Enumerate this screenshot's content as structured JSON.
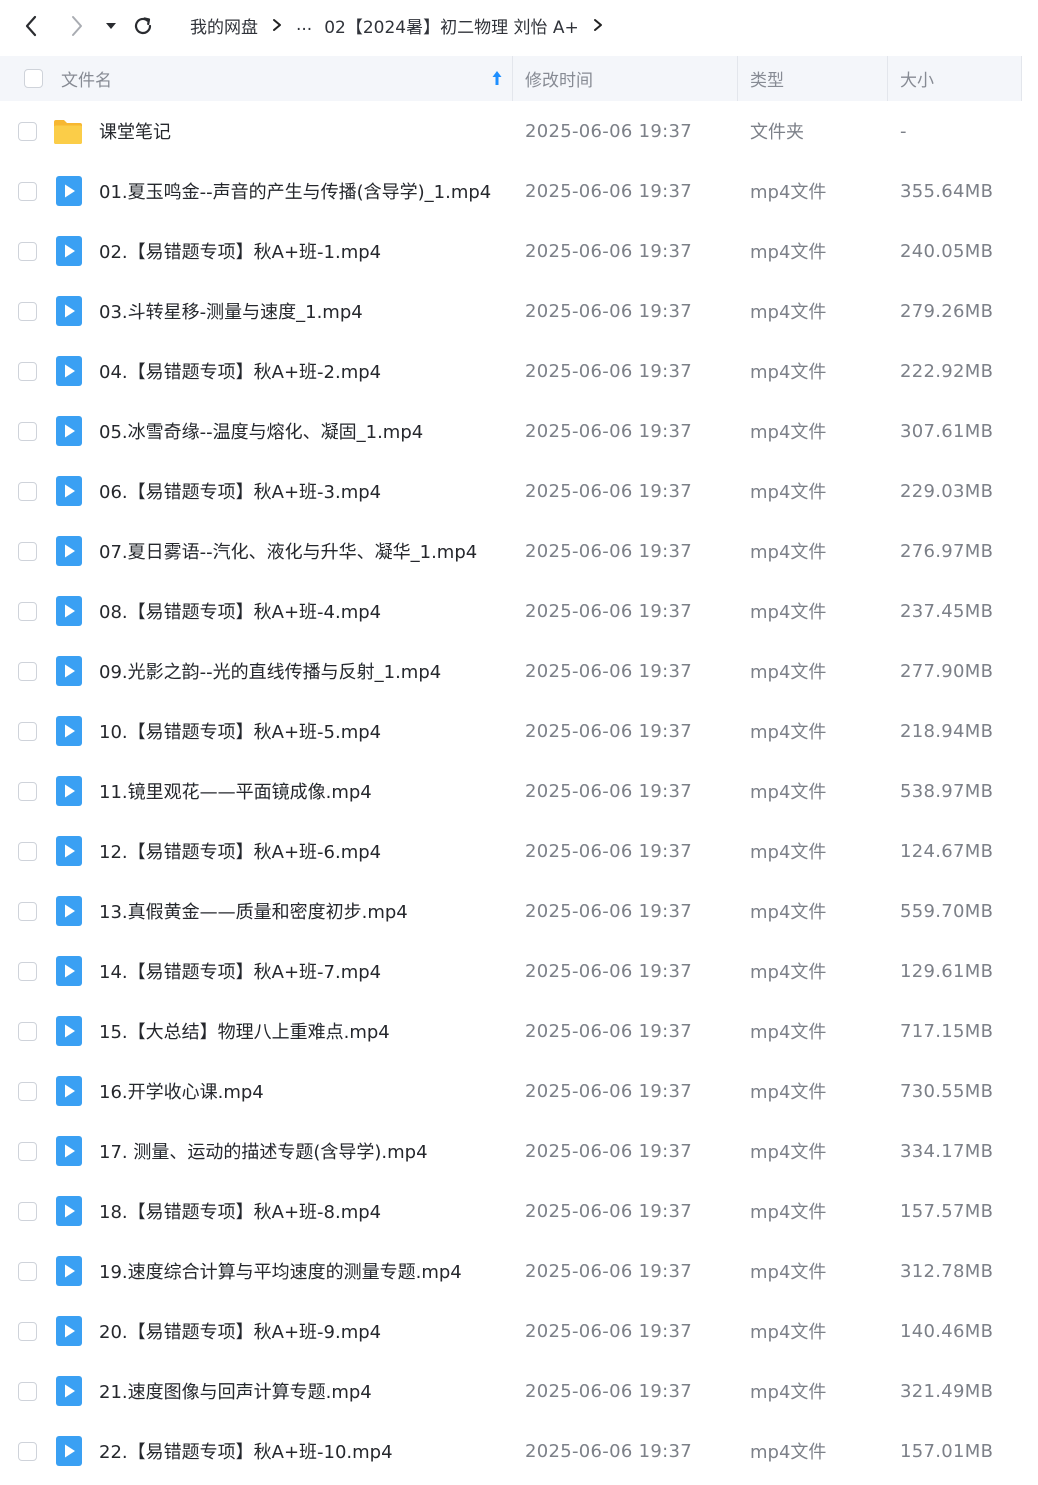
{
  "breadcrumb": {
    "root": "我的网盘",
    "ellipsis": "...",
    "current": "02【2024暑】初二物理 刘怡 A+"
  },
  "columns": {
    "name": "文件名",
    "modified": "修改时间",
    "type": "类型",
    "size": "大小"
  },
  "colors": {
    "accent": "#1e8fff",
    "folder": "#f9c646",
    "video_icon": "#3aa0f3",
    "header_bg": "#f4f6fa"
  },
  "files": [
    {
      "icon": "folder-icon",
      "name": "课堂笔记",
      "modified": "2025-06-06 19:37",
      "type": "文件夹",
      "size": "-"
    },
    {
      "icon": "video-file-icon",
      "name": "01.夏玉鸣金--声音的产生与传播(含导学)_1.mp4",
      "modified": "2025-06-06 19:37",
      "type": "mp4文件",
      "size": "355.64MB"
    },
    {
      "icon": "video-file-icon",
      "name": "02.【易错题专项】秋A+班-1.mp4",
      "modified": "2025-06-06 19:37",
      "type": "mp4文件",
      "size": "240.05MB"
    },
    {
      "icon": "video-file-icon",
      "name": "03.斗转星移-测量与速度_1.mp4",
      "modified": "2025-06-06 19:37",
      "type": "mp4文件",
      "size": "279.26MB"
    },
    {
      "icon": "video-file-icon",
      "name": "04.【易错题专项】秋A+班-2.mp4",
      "modified": "2025-06-06 19:37",
      "type": "mp4文件",
      "size": "222.92MB"
    },
    {
      "icon": "video-file-icon",
      "name": "05.冰雪奇缘--温度与熔化、凝固_1.mp4",
      "modified": "2025-06-06 19:37",
      "type": "mp4文件",
      "size": "307.61MB"
    },
    {
      "icon": "video-file-icon",
      "name": "06.【易错题专项】秋A+班-3.mp4",
      "modified": "2025-06-06 19:37",
      "type": "mp4文件",
      "size": "229.03MB"
    },
    {
      "icon": "video-file-icon",
      "name": "07.夏日雾语--汽化、液化与升华、凝华_1.mp4",
      "modified": "2025-06-06 19:37",
      "type": "mp4文件",
      "size": "276.97MB"
    },
    {
      "icon": "video-file-icon",
      "name": "08.【易错题专项】秋A+班-4.mp4",
      "modified": "2025-06-06 19:37",
      "type": "mp4文件",
      "size": "237.45MB"
    },
    {
      "icon": "video-file-icon",
      "name": "09.光影之韵--光的直线传播与反射_1.mp4",
      "modified": "2025-06-06 19:37",
      "type": "mp4文件",
      "size": "277.90MB"
    },
    {
      "icon": "video-file-icon",
      "name": "10.【易错题专项】秋A+班-5.mp4",
      "modified": "2025-06-06 19:37",
      "type": "mp4文件",
      "size": "218.94MB"
    },
    {
      "icon": "video-file-icon",
      "name": "11.镜里观花——平面镜成像.mp4",
      "modified": "2025-06-06 19:37",
      "type": "mp4文件",
      "size": "538.97MB"
    },
    {
      "icon": "video-file-icon",
      "name": "12.【易错题专项】秋A+班-6.mp4",
      "modified": "2025-06-06 19:37",
      "type": "mp4文件",
      "size": "124.67MB"
    },
    {
      "icon": "video-file-icon",
      "name": "13.真假黄金——质量和密度初步.mp4",
      "modified": "2025-06-06 19:37",
      "type": "mp4文件",
      "size": "559.70MB"
    },
    {
      "icon": "video-file-icon",
      "name": "14.【易错题专项】秋A+班-7.mp4",
      "modified": "2025-06-06 19:37",
      "type": "mp4文件",
      "size": "129.61MB"
    },
    {
      "icon": "video-file-icon",
      "name": "15.【大总结】物理八上重难点.mp4",
      "modified": "2025-06-06 19:37",
      "type": "mp4文件",
      "size": "717.15MB"
    },
    {
      "icon": "video-file-icon",
      "name": "16.开学收心课.mp4",
      "modified": "2025-06-06 19:37",
      "type": "mp4文件",
      "size": "730.55MB"
    },
    {
      "icon": "video-file-icon",
      "name": "17. 测量、运动的描述专题(含导学).mp4",
      "modified": "2025-06-06 19:37",
      "type": "mp4文件",
      "size": "334.17MB"
    },
    {
      "icon": "video-file-icon",
      "name": "18.【易错题专项】秋A+班-8.mp4",
      "modified": "2025-06-06 19:37",
      "type": "mp4文件",
      "size": "157.57MB"
    },
    {
      "icon": "video-file-icon",
      "name": "19.速度综合计算与平均速度的测量专题.mp4",
      "modified": "2025-06-06 19:37",
      "type": "mp4文件",
      "size": "312.78MB"
    },
    {
      "icon": "video-file-icon",
      "name": "20.【易错题专项】秋A+班-9.mp4",
      "modified": "2025-06-06 19:37",
      "type": "mp4文件",
      "size": "140.46MB"
    },
    {
      "icon": "video-file-icon",
      "name": "21.速度图像与回声计算专题.mp4",
      "modified": "2025-06-06 19:37",
      "type": "mp4文件",
      "size": "321.49MB"
    },
    {
      "icon": "video-file-icon",
      "name": "22.【易错题专项】秋A+班-10.mp4",
      "modified": "2025-06-06 19:37",
      "type": "mp4文件",
      "size": "157.01MB"
    }
  ]
}
